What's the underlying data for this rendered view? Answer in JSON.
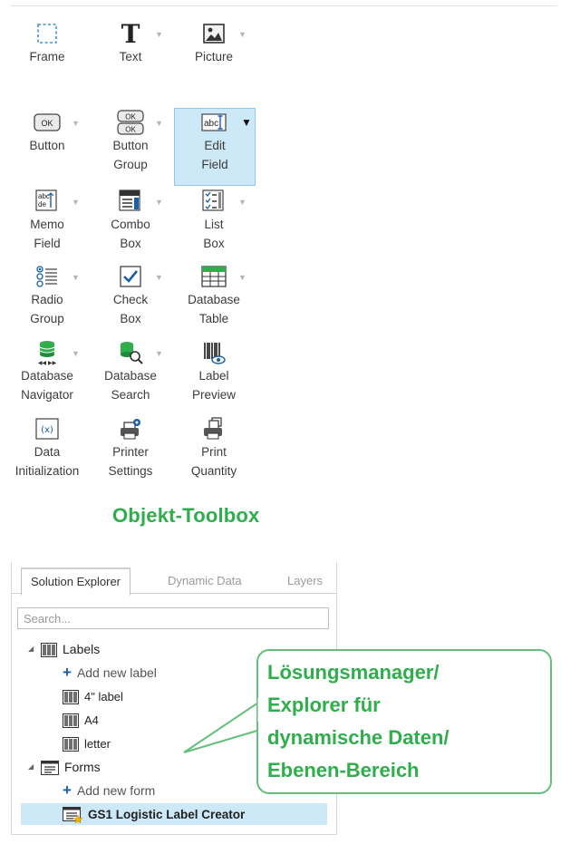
{
  "toolbox": {
    "items": [
      {
        "label": "Frame",
        "icon": "frame-icon",
        "has_arrow": false
      },
      {
        "label": "Text",
        "icon": "text-icon",
        "has_arrow": true
      },
      {
        "label": "Picture",
        "icon": "picture-icon",
        "has_arrow": true
      },
      {
        "label": "Button",
        "icon": "button-icon",
        "has_arrow": true
      },
      {
        "label": "Button\nGroup",
        "icon": "button-group-icon",
        "has_arrow": true
      },
      {
        "label": "Edit\nField",
        "icon": "edit-field-icon",
        "has_arrow": true,
        "selected": true
      },
      {
        "label": "Memo\nField",
        "icon": "memo-field-icon",
        "has_arrow": true
      },
      {
        "label": "Combo\nBox",
        "icon": "combo-box-icon",
        "has_arrow": true
      },
      {
        "label": "List\nBox",
        "icon": "list-box-icon",
        "has_arrow": true
      },
      {
        "label": "Radio\nGroup",
        "icon": "radio-group-icon",
        "has_arrow": true
      },
      {
        "label": "Check\nBox",
        "icon": "check-box-icon",
        "has_arrow": true
      },
      {
        "label": "Database\nTable",
        "icon": "database-table-icon",
        "has_arrow": true
      },
      {
        "label": "Database\nNavigator",
        "icon": "database-navigator-icon",
        "has_arrow": true
      },
      {
        "label": "Database\nSearch",
        "icon": "database-search-icon",
        "has_arrow": true
      },
      {
        "label": "Label\nPreview",
        "icon": "label-preview-icon",
        "has_arrow": false
      },
      {
        "label": "Data\nInitialization",
        "icon": "data-initialization-icon",
        "has_arrow": false
      },
      {
        "label": "Printer\nSettings",
        "icon": "printer-settings-icon",
        "has_arrow": false
      },
      {
        "label": "Print\nQuantity",
        "icon": "print-quantity-icon",
        "has_arrow": false
      }
    ],
    "title": "Objekt-Toolbox",
    "accent_color": "#2fae4c",
    "selected_bg": "#cde8f7"
  },
  "explorer": {
    "tabs": [
      "Solution Explorer",
      "Dynamic Data",
      "Layers"
    ],
    "active_tab": "Solution Explorer",
    "search_placeholder": "Search...",
    "tree": {
      "labels_group": "Labels",
      "add_label": "Add new label",
      "labels": [
        "4\" label",
        "A4",
        "letter"
      ],
      "forms_group": "Forms",
      "add_form": "Add new form",
      "forms": [
        "GS1 Logistic Label Creator"
      ]
    }
  },
  "callout": {
    "text": "Lösungsmanager/\nExplorer für\ndynamische Daten/\nEbenen-Bereich",
    "border_color": "#62c07a"
  }
}
